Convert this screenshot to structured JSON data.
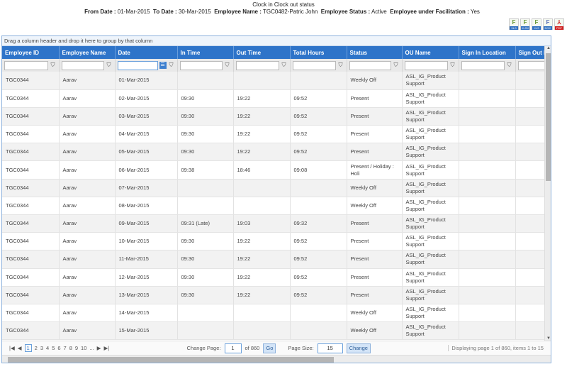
{
  "title": "Clock in Clock out status",
  "info": {
    "from_label": "From Date :",
    "from": "01-Mar-2015",
    "to_label": "To Date :",
    "to": "30-Mar-2015",
    "name_label": "Employee Name :",
    "name": "TGC0482-Patric John",
    "status_label": "Employee Status :",
    "status": "Active",
    "facil_label": "Employee under Facilitation :",
    "facil": "Yes"
  },
  "exports": [
    {
      "label": "XLS",
      "icon": "excel-icon"
    },
    {
      "label": "XLSX",
      "icon": "excel-icon"
    },
    {
      "label": "XLS",
      "icon": "excel-icon"
    },
    {
      "label": "DOC",
      "icon": "word-icon"
    },
    {
      "label": "PDF",
      "icon": "pdf-icon"
    }
  ],
  "grid": {
    "group_hint": "Drag a column header and drop it here to group by that column",
    "columns": [
      "Employee ID",
      "Employee Name",
      "Date",
      "In Time",
      "Out Time",
      "Total Hours",
      "Status",
      "OU Name",
      "Sign In Location",
      "Sign Out L"
    ],
    "rows": [
      [
        "TGC0344",
        "Aarav",
        "01-Mar-2015",
        "",
        "",
        "",
        "Weekly Off",
        "ASL_IG_Product Support",
        "",
        ""
      ],
      [
        "TGC0344",
        "Aarav",
        "02-Mar-2015",
        "09:30",
        "19:22",
        "09:52",
        "Present",
        "ASL_IG_Product Support",
        "",
        ""
      ],
      [
        "TGC0344",
        "Aarav",
        "03-Mar-2015",
        "09:30",
        "19:22",
        "09:52",
        "Present",
        "ASL_IG_Product Support",
        "",
        ""
      ],
      [
        "TGC0344",
        "Aarav",
        "04-Mar-2015",
        "09:30",
        "19:22",
        "09:52",
        "Present",
        "ASL_IG_Product Support",
        "",
        ""
      ],
      [
        "TGC0344",
        "Aarav",
        "05-Mar-2015",
        "09:30",
        "19:22",
        "09:52",
        "Present",
        "ASL_IG_Product Support",
        "",
        ""
      ],
      [
        "TGC0344",
        "Aarav",
        "06-Mar-2015",
        "09:38",
        "18:46",
        "09:08",
        "Present / Holiday : Holi",
        "ASL_IG_Product Support",
        "",
        ""
      ],
      [
        "TGC0344",
        "Aarav",
        "07-Mar-2015",
        "",
        "",
        "",
        "Weekly Off",
        "ASL_IG_Product Support",
        "",
        ""
      ],
      [
        "TGC0344",
        "Aarav",
        "08-Mar-2015",
        "",
        "",
        "",
        "Weekly Off",
        "ASL_IG_Product Support",
        "",
        ""
      ],
      [
        "TGC0344",
        "Aarav",
        "09-Mar-2015",
        "09:31 (Late)",
        "19:03",
        "09:32",
        "Present",
        "ASL_IG_Product Support",
        "",
        ""
      ],
      [
        "TGC0344",
        "Aarav",
        "10-Mar-2015",
        "09:30",
        "19:22",
        "09:52",
        "Present",
        "ASL_IG_Product Support",
        "",
        ""
      ],
      [
        "TGC0344",
        "Aarav",
        "11-Mar-2015",
        "09:30",
        "19:22",
        "09:52",
        "Present",
        "ASL_IG_Product Support",
        "",
        ""
      ],
      [
        "TGC0344",
        "Aarav",
        "12-Mar-2015",
        "09:30",
        "19:22",
        "09:52",
        "Present",
        "ASL_IG_Product Support",
        "",
        ""
      ],
      [
        "TGC0344",
        "Aarav",
        "13-Mar-2015",
        "09:30",
        "19:22",
        "09:52",
        "Present",
        "ASL_IG_Product Support",
        "",
        ""
      ],
      [
        "TGC0344",
        "Aarav",
        "14-Mar-2015",
        "",
        "",
        "",
        "Weekly Off",
        "ASL_IG_Product Support",
        "",
        ""
      ],
      [
        "TGC0344",
        "Aarav",
        "15-Mar-2015",
        "",
        "",
        "",
        "Weekly Off",
        "ASL_IG_Product Support",
        "",
        ""
      ]
    ]
  },
  "pager": {
    "pages": [
      "1",
      "2",
      "3",
      "4",
      "5",
      "6",
      "7",
      "8",
      "9",
      "10",
      "..."
    ],
    "current": "1",
    "change_page_label": "Change Page:",
    "page_value": "1",
    "of_label": "of 860",
    "go": "Go",
    "page_size_label": "Page Size:",
    "page_size": "15",
    "change": "Change",
    "status": "Displaying page 1 of 860, items 1 to 15"
  },
  "colors": {
    "header": "#2e74c9",
    "accent": "#6aa0dc"
  }
}
